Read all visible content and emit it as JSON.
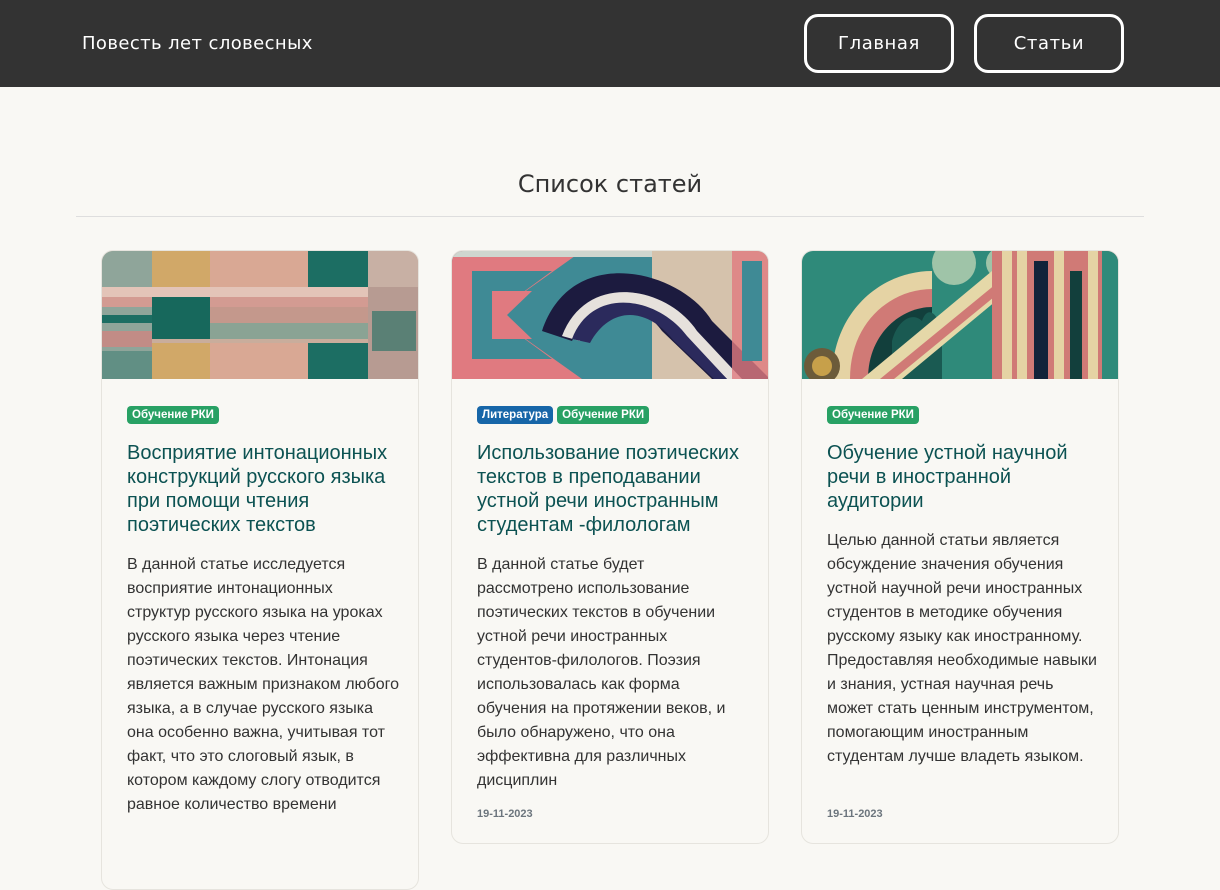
{
  "navbar": {
    "brand": "Повесть лет словесных",
    "links": [
      {
        "label": "Главная"
      },
      {
        "label": "Статьи"
      }
    ]
  },
  "page": {
    "heading": "Список статей"
  },
  "articles": [
    {
      "tags": [
        {
          "label": "Обучение РКИ",
          "color": "#28a164"
        }
      ],
      "title": "Восприятие интонационных конструкций русского языка при помощи чтения поэтических текстов",
      "summary": "В данной статье исследуется восприятие интонационных структур русского языка на уроках русского языка через чтение поэтических текстов. Интонация является важным признаком любого языка, а в случае русского языка она особенно важна, учитывая тот факт, что это слоговый язык, в котором каждому слогу отводится равное количество времени",
      "date": ""
    },
    {
      "tags": [
        {
          "label": "Литература",
          "color": "#1766a8"
        },
        {
          "label": "Обучение РКИ",
          "color": "#28a164"
        }
      ],
      "title": "Использование поэтических текстов в преподавании устной речи иностранным студентам -филологам",
      "summary": "В данной статье будет рассмотрено использование поэтических текстов в обучении устной речи иностранных студентов-филологов. Поэзия использовалась как форма обучения на протяжении веков, и было обнаружено, что она эффективна для различных дисциплин",
      "date": "19-11-2023"
    },
    {
      "tags": [
        {
          "label": "Обучение РКИ",
          "color": "#28a164"
        }
      ],
      "title": "Обучение устной научной речи в иностранной аудитории",
      "summary": "Целью данной статьи является обсуждение значения обучения устной научной речи иностранных студентов в методике обучения русскому языку как иностранному. Предоставляя необходимые навыки и знания, устная научная речь может стать ценным инструментом, помогающим иностранным студентам лучше владеть языком.",
      "date": "19-11-2023"
    }
  ]
}
